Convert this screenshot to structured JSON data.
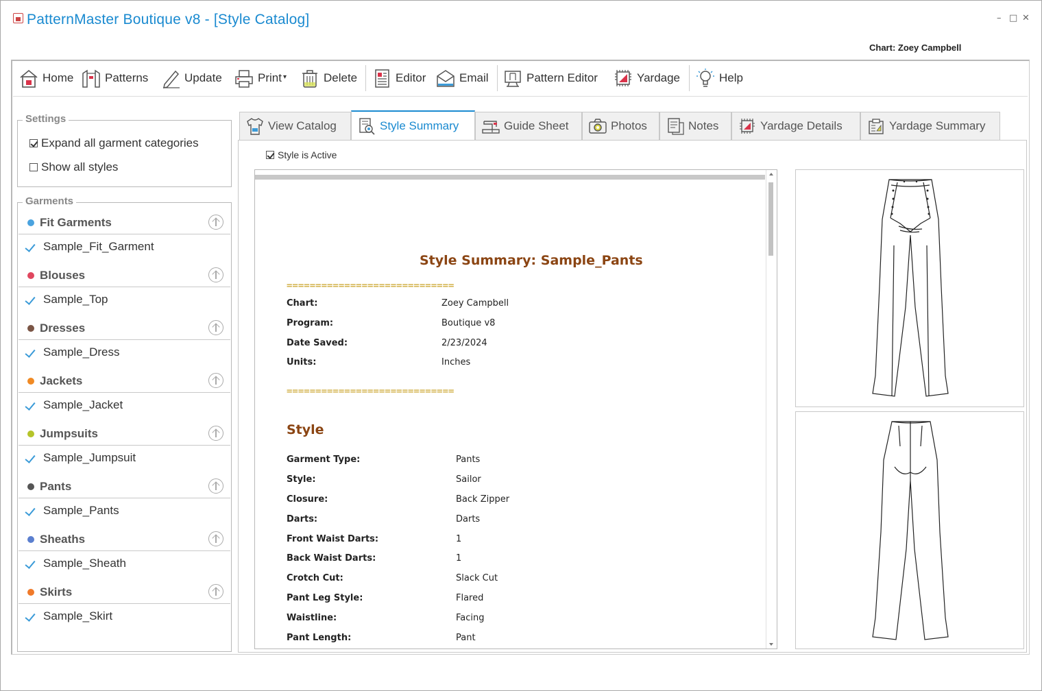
{
  "window": {
    "title": "PatternMaster Boutique v8 - [Style Catalog]",
    "minimize": "–",
    "maximize": "□",
    "close": "✕",
    "chart_label": "Chart: Zoey Campbell"
  },
  "toolbar": {
    "items": [
      {
        "label": "Home",
        "icon": "home-icon"
      },
      {
        "label": "Patterns",
        "icon": "patterns-icon"
      },
      {
        "label": "Update",
        "icon": "pencil-icon"
      },
      {
        "label": "Print",
        "icon": "printer-icon"
      },
      {
        "label": "Delete",
        "icon": "trash-icon"
      },
      {
        "label": "Editor",
        "icon": "document-icon"
      },
      {
        "label": "Email",
        "icon": "envelope-icon"
      },
      {
        "label": "Pattern Editor",
        "icon": "pattern-editor-icon"
      },
      {
        "label": "Yardage",
        "icon": "yardage-icon"
      },
      {
        "label": "Help",
        "icon": "lightbulb-icon"
      }
    ],
    "print_dropdown": "▾"
  },
  "settings": {
    "title": "Settings",
    "expand_all": {
      "label": "Expand all garment categories",
      "checked": true
    },
    "show_all": {
      "label": "Show all styles",
      "checked": false
    }
  },
  "garments": {
    "title": "Garments",
    "categories": [
      {
        "label": "Fit Garments",
        "color": "#4aa3df",
        "item": "Sample_Fit_Garment"
      },
      {
        "label": "Blouses",
        "color": "#e0475f",
        "item": "Sample_Top"
      },
      {
        "label": "Dresses",
        "color": "#7a5545",
        "item": "Sample_Dress"
      },
      {
        "label": "Jackets",
        "color": "#f08a24",
        "item": "Sample_Jacket"
      },
      {
        "label": "Jumpsuits",
        "color": "#b5c42a",
        "item": "Sample_Jumpsuit"
      },
      {
        "label": "Pants",
        "color": "#555555",
        "item": "Sample_Pants"
      },
      {
        "label": "Sheaths",
        "color": "#5b7fcf",
        "item": "Sample_Sheath"
      },
      {
        "label": "Skirts",
        "color": "#f07a2a",
        "item": "Sample_Skirt"
      }
    ]
  },
  "tabs": [
    {
      "label": "View Catalog",
      "icon": "shirt-icon",
      "active": false
    },
    {
      "label": "Style Summary",
      "icon": "summary-icon",
      "active": true
    },
    {
      "label": "Guide Sheet",
      "icon": "sewing-machine-icon",
      "active": false
    },
    {
      "label": "Photos",
      "icon": "camera-icon",
      "active": false
    },
    {
      "label": "Notes",
      "icon": "notes-icon",
      "active": false
    },
    {
      "label": "Yardage Details",
      "icon": "yardage-details-icon",
      "active": false
    },
    {
      "label": "Yardage Summary",
      "icon": "yardage-summary-icon",
      "active": false
    }
  ],
  "style_active": {
    "label": "Style is Active",
    "checked": true
  },
  "summary": {
    "title": "Style Summary: Sample_Pants",
    "rule": "=============================",
    "header_fields": [
      {
        "key": "Chart:",
        "value": "Zoey Campbell"
      },
      {
        "key": "Program:",
        "value": "Boutique v8"
      },
      {
        "key": "Date Saved:",
        "value": "2/23/2024"
      },
      {
        "key": "Units:",
        "value": "Inches"
      }
    ],
    "style_heading": "Style",
    "style_fields": [
      {
        "key": "Garment Type:",
        "value": "Pants"
      },
      {
        "key": "Style:",
        "value": "Sailor"
      },
      {
        "key": "Closure:",
        "value": "Back Zipper"
      },
      {
        "key": "Darts:",
        "value": "Darts"
      },
      {
        "key": "Front Waist Darts:",
        "value": "1"
      },
      {
        "key": "Back Waist Darts:",
        "value": "1"
      },
      {
        "key": "Crotch Cut:",
        "value": "Slack Cut"
      },
      {
        "key": "Pant Leg Style:",
        "value": "Flared"
      },
      {
        "key": "Waistline:",
        "value": "Facing"
      },
      {
        "key": "Pant Length:",
        "value": "Pant"
      }
    ]
  }
}
